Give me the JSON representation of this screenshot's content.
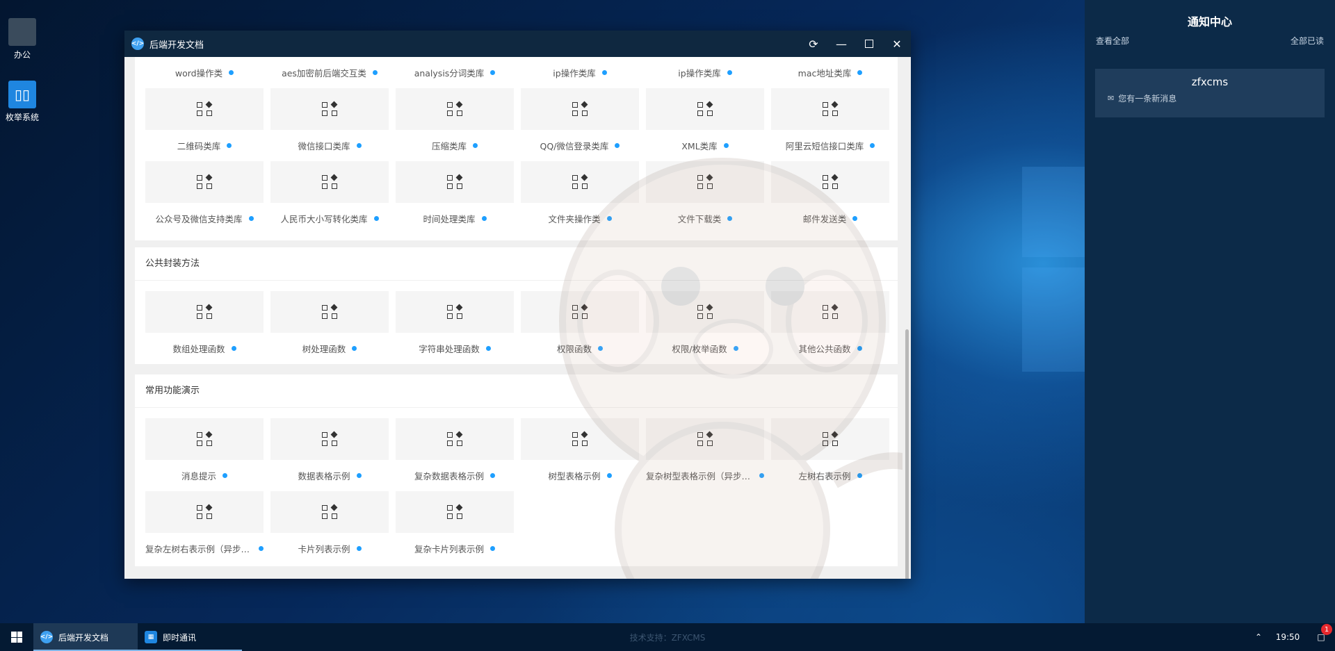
{
  "desktop": {
    "icons": [
      {
        "label": "办公",
        "icon": "office-icon"
      },
      {
        "label": "枚举系统",
        "icon": "enum-system-icon"
      }
    ]
  },
  "window": {
    "title": "后端开发文档",
    "buttons": [
      "refresh-icon",
      "minimize-icon",
      "maximize-icon",
      "close-icon"
    ],
    "library_rows": [
      [
        "word操作类",
        "aes加密前后端交互类",
        "analysis分词类库",
        "ip操作类库",
        "ip操作类库",
        "mac地址类库"
      ],
      [
        "二维码类库",
        "微信接口类库",
        "压缩类库",
        "QQ/微信登录类库",
        "XML类库",
        "阿里云短信接口类库"
      ],
      [
        "公众号及微信支持类库",
        "人民币大小写转化类库",
        "时间处理类库",
        "文件夹操作类",
        "文件下载类",
        "邮件发送类"
      ]
    ],
    "sections": [
      {
        "title": "公共封装方法",
        "items": [
          "数组处理函数",
          "树处理函数",
          "字符串处理函数",
          "权限函数",
          "权限/枚举函数",
          "其他公共函数"
        ]
      },
      {
        "title": "常用功能演示",
        "items": [
          "消息提示",
          "数据表格示例",
          "复杂数据表格示例",
          "树型表格示例",
          "复杂树型表格示例（异步）...",
          "左树右表示例",
          "复杂左树右表示例（异步）...",
          "卡片列表示例",
          "复杂卡片列表示例"
        ]
      }
    ]
  },
  "notify": {
    "title": "通知中心",
    "view_all": "查看全部",
    "mark_read": "全部已读",
    "message": {
      "from": "zfxcms",
      "text": "您有一条新消息"
    }
  },
  "taskbar": {
    "items": [
      "后端开发文档",
      "即时通讯"
    ],
    "support": "技术支持：ZFXCMS",
    "time": "19:50",
    "badge": "1"
  },
  "colors": {
    "accent": "#1e9fff",
    "titlebar": "#0f2840",
    "taskbar": "#041a33",
    "notify_bg": "#0c2a48"
  }
}
